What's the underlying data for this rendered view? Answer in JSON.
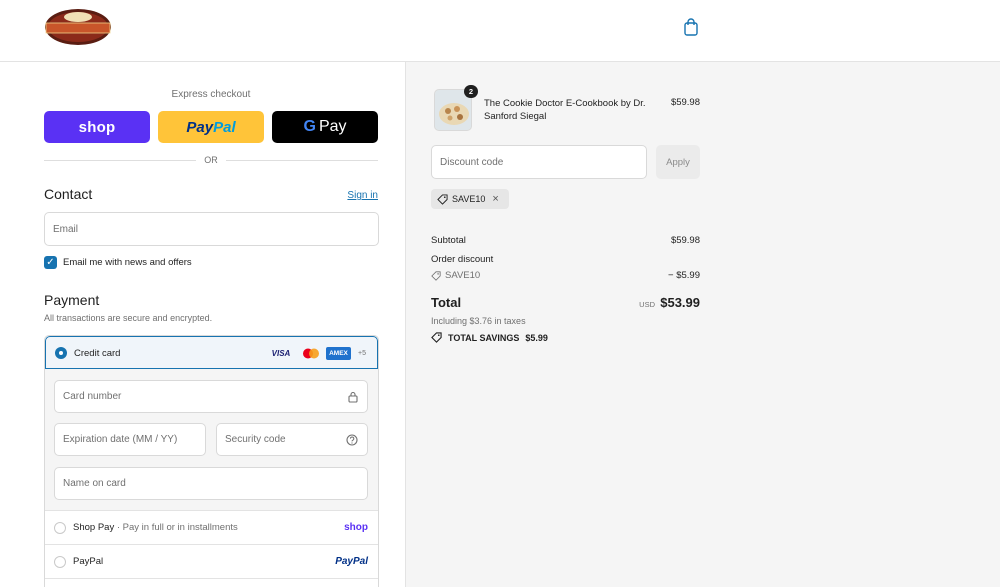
{
  "header": {
    "logo_alt": "Dr. Siegal's Cookie Diet"
  },
  "express": {
    "label": "Express checkout",
    "shop_label": "shop",
    "paypal_label_a": "Pay",
    "paypal_label_b": "Pal",
    "gpay_g": "G",
    "gpay_label": "Pay",
    "or_label": "OR"
  },
  "contact": {
    "title": "Contact",
    "signin": "Sign in",
    "email_placeholder": "Email",
    "news_label": "Email me with news and offers"
  },
  "payment": {
    "title": "Payment",
    "subtitle": "All transactions are secure and encrypted.",
    "credit_card_label": "Credit card",
    "card_logos": [
      "VISA",
      "AMEX",
      "+5"
    ],
    "card_number_placeholder": "Card number",
    "expiry_placeholder": "Expiration date (MM / YY)",
    "security_placeholder": "Security code",
    "name_placeholder": "Name on card",
    "shoppay_label": "Shop Pay",
    "shoppay_sub": "· Pay in full or in installments",
    "shoppay_brand": "shop",
    "paypal_label": "PayPal",
    "paypal_brand": "PayPal"
  },
  "summary": {
    "item": {
      "name": "The Cookie Doctor E-Cookbook by Dr. Sanford Siegal",
      "price": "$59.98",
      "qty": "2"
    },
    "discount_placeholder": "Discount code",
    "apply_label": "Apply",
    "code_chip": "SAVE10",
    "subtotal_label": "Subtotal",
    "subtotal_value": "$59.98",
    "order_discount_label": "Order discount",
    "discount_code": "SAVE10",
    "discount_value": "− $5.99",
    "total_label": "Total",
    "currency": "USD",
    "total_value": "$53.99",
    "taxes": "Including $3.76 in taxes",
    "savings_label": "TOTAL SAVINGS",
    "savings_value": "$5.99"
  },
  "colors": {
    "accent": "#1773b0",
    "shop_purple": "#5a31f4",
    "paypal_yellow": "#ffc439"
  }
}
